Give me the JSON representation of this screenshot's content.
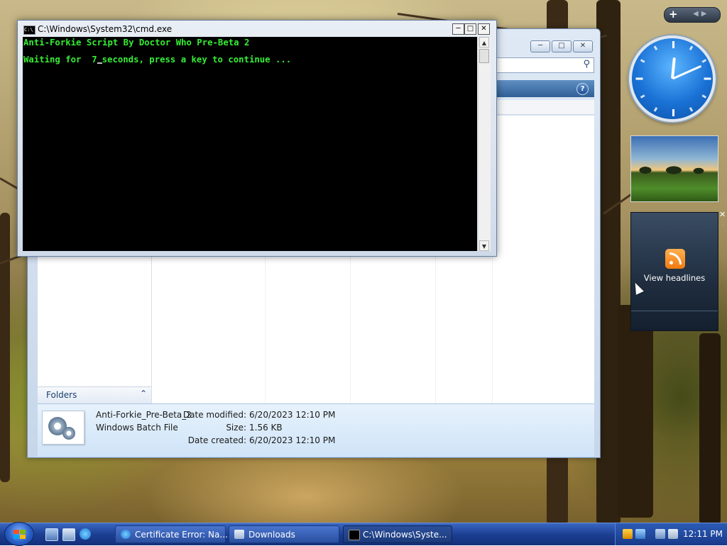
{
  "cmd_window": {
    "title": "C:\\Windows\\System32\\cmd.exe",
    "icon_text": "C:\\",
    "lines": [
      "Anti-Forkie Script By Doctor Who Pre-Beta 2",
      "Waiting for  7",
      "seconds, press a key to continue ..."
    ],
    "text_color": "#35ee35",
    "background_color": "#000000"
  },
  "explorer_window": {
    "nav_pane": {
      "folders_label": "Folders"
    },
    "details": {
      "file_name": "Anti-Forkie_Pre-Beta_2",
      "file_type": "Windows Batch File",
      "date_modified_label": "Date modified:",
      "date_modified_value": "6/20/2023 12:10 PM",
      "size_label": "Size:",
      "size_value": "1.56 KB",
      "date_created_label": "Date created:",
      "date_created_value": "6/20/2023 12:10 PM"
    }
  },
  "sidebar": {
    "feed_gadget": {
      "label": "View headlines"
    },
    "clock_gadget": {
      "hour": 12,
      "minute": 11
    }
  },
  "taskbar": {
    "tasks": [
      {
        "label": "Certificate Error: Na...",
        "icon": "ie-icon"
      },
      {
        "label": "Downloads",
        "icon": "folder-icon"
      },
      {
        "label": "C:\\Windows\\Syste...",
        "icon": "cmd-icon"
      }
    ],
    "clock": "12:11 PM"
  },
  "colors": {
    "taskbar": "#1c3f93",
    "explorer_details": "#cfe4f8",
    "clock_face": "#1a72d6"
  }
}
